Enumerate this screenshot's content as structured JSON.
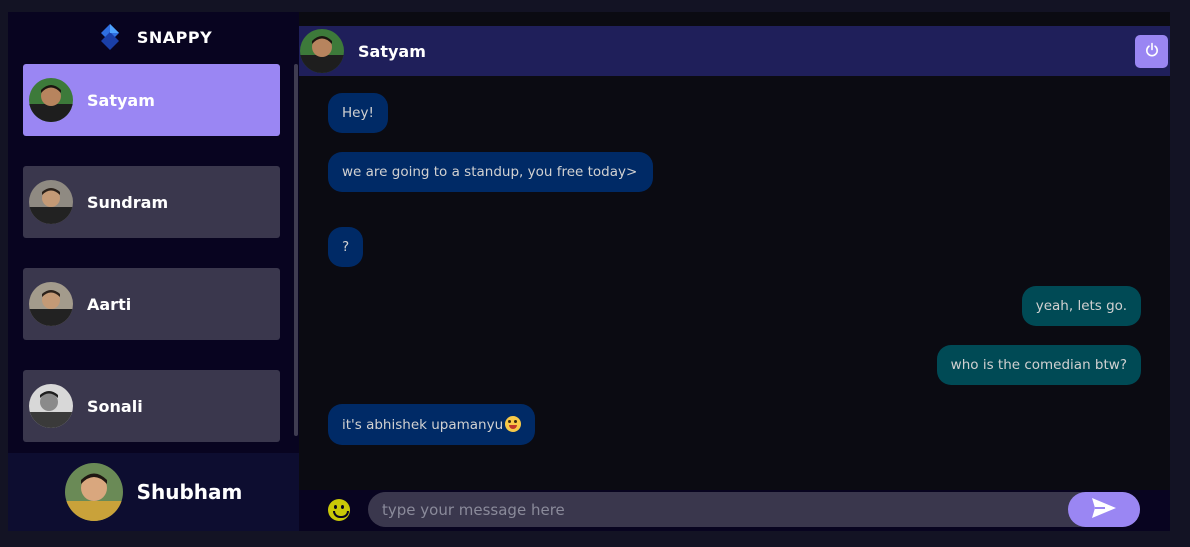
{
  "app": {
    "brand_name": "SNAPPY"
  },
  "contacts": [
    {
      "name": "Satyam",
      "selected": true
    },
    {
      "name": "Sundram",
      "selected": false
    },
    {
      "name": "Aarti",
      "selected": false
    },
    {
      "name": "Sonali",
      "selected": false
    }
  ],
  "current_user": {
    "name": "Shubham"
  },
  "chat": {
    "header_name": "Satyam",
    "messages": [
      {
        "direction": "received",
        "text": "Hey!"
      },
      {
        "direction": "received",
        "text": "we are going to a standup, you free today>"
      },
      {
        "direction": "received",
        "text": "?"
      },
      {
        "direction": "sent",
        "text": "yeah, lets go."
      },
      {
        "direction": "sent",
        "text": "who is the comedian btw?"
      },
      {
        "direction": "received",
        "text": "it's abhishek upamanyu",
        "emoji": "grinning-face-with-tongue"
      }
    ],
    "input": {
      "placeholder": "type your message here",
      "value": ""
    }
  },
  "icons": {
    "logout": "power-icon",
    "send": "send-icon",
    "emoji_picker": "smiley-icon",
    "brand": "snappy-logo-icon"
  },
  "colors": {
    "background": "#131324",
    "accent": "#9a86f3",
    "header": "#1f1f5a",
    "received_bubble": "#002a66",
    "sent_bubble": "#004a55"
  }
}
